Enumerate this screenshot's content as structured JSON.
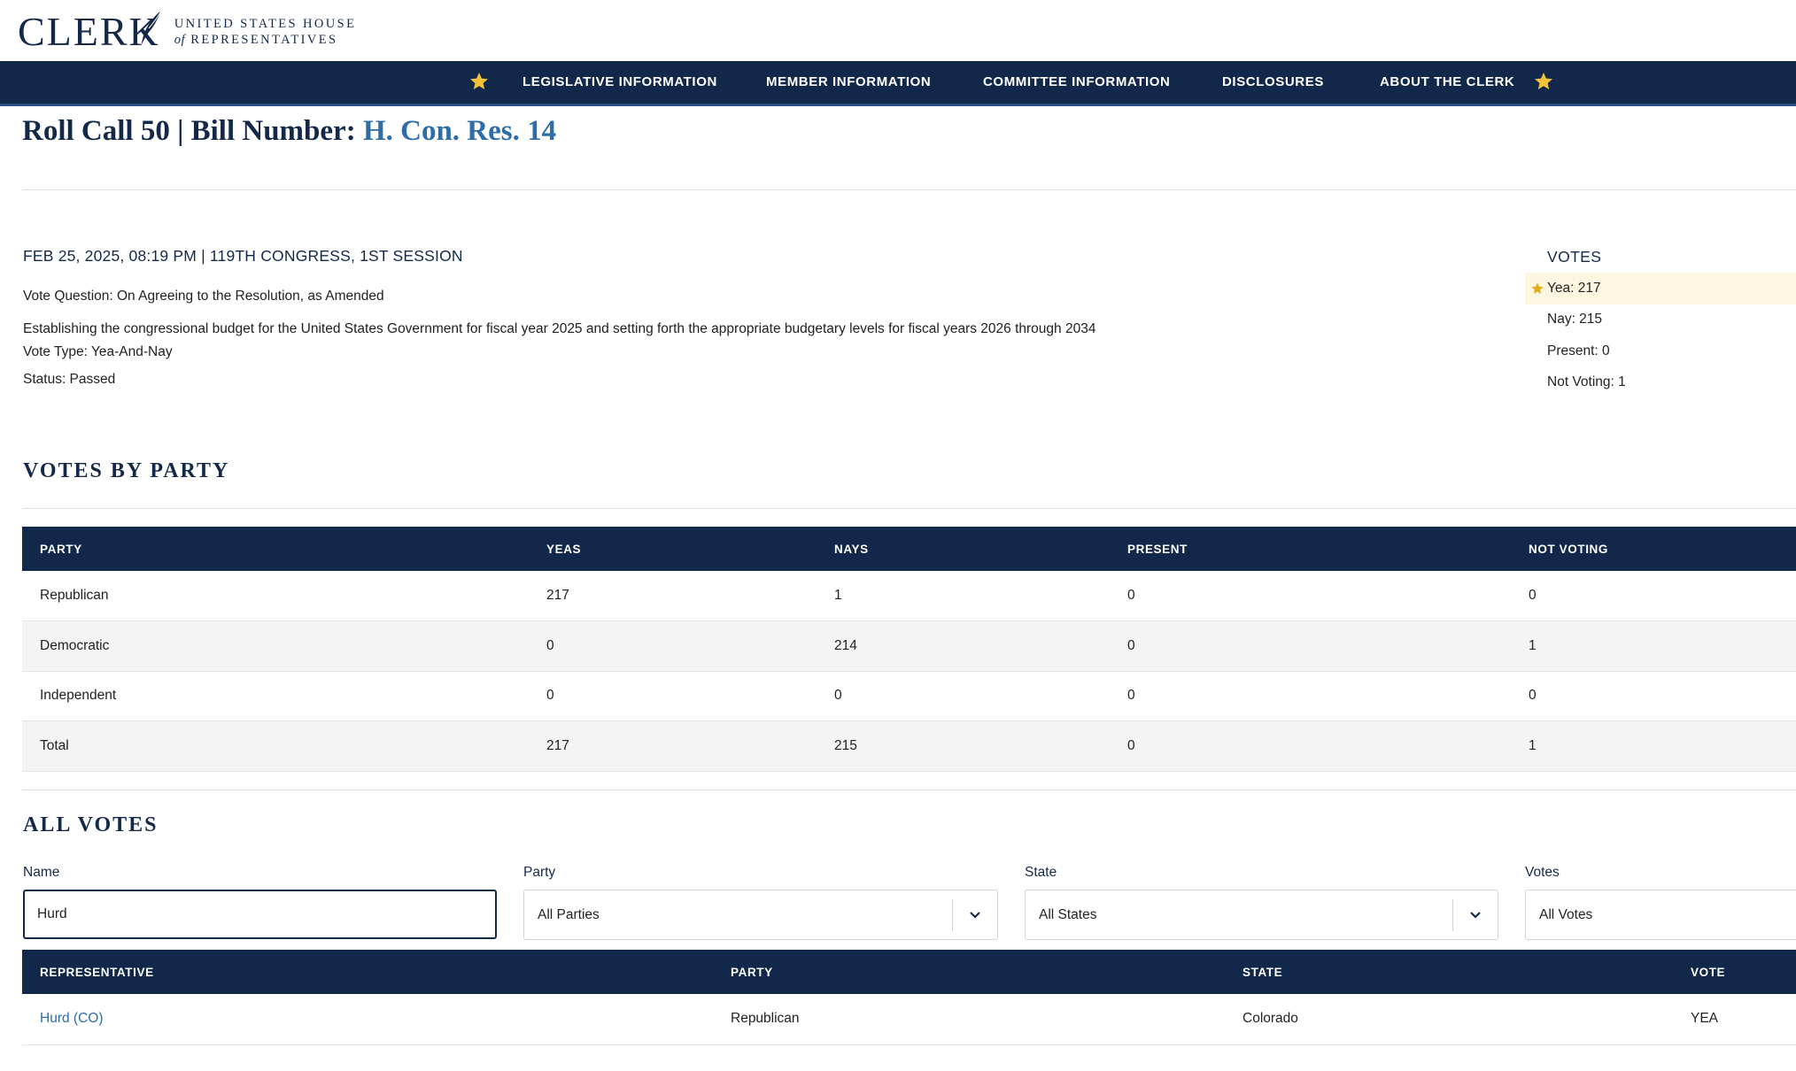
{
  "header": {
    "logo_word": "CLERK",
    "logo_line1": "United States House",
    "logo_of": "of",
    "logo_line2": "Representatives"
  },
  "nav": {
    "items": [
      {
        "label": "LEGISLATIVE INFORMATION"
      },
      {
        "label": "MEMBER INFORMATION"
      },
      {
        "label": "COMMITTEE INFORMATION"
      },
      {
        "label": "DISCLOSURES"
      },
      {
        "label": "ABOUT THE CLERK"
      }
    ],
    "star_color": "#f2c23a"
  },
  "title": {
    "prefix": "Roll Call 50 | Bill Number: ",
    "bill": "H. Con. Res. 14"
  },
  "meta": {
    "heading": "FEB 25, 2025, 08:19 PM | 119TH CONGRESS, 1ST SESSION",
    "question": "Vote Question: On Agreeing to the Resolution, as Amended",
    "description": "Establishing the congressional budget for the United States Government for fiscal year 2025 and setting forth the appropriate budgetary levels for fiscal years 2026 through 2034",
    "type": "Vote Type: Yea-And-Nay",
    "status": "Status: Passed"
  },
  "votes_summary": {
    "title": "VOTES",
    "items": [
      {
        "label": "Yea: 217"
      },
      {
        "label": "Nay: 215"
      },
      {
        "label": "Present: 0"
      },
      {
        "label": "Not Voting: 1"
      }
    ]
  },
  "party_section": {
    "heading": "VOTES BY PARTY",
    "columns": [
      "PARTY",
      "YEAS",
      "NAYS",
      "PRESENT",
      "NOT VOTING"
    ],
    "rows": [
      [
        "Republican",
        "217",
        "1",
        "0",
        "0"
      ],
      [
        "Democratic",
        "0",
        "214",
        "0",
        "1"
      ],
      [
        "Independent",
        "0",
        "0",
        "0",
        "0"
      ],
      [
        "Total",
        "217",
        "215",
        "0",
        "1"
      ]
    ]
  },
  "all_votes": {
    "heading": "ALL VOTES",
    "filters": {
      "name_label": "Name",
      "name_value": "Hurd",
      "party_label": "Party",
      "party_value": "All Parties",
      "state_label": "State",
      "state_value": "All States",
      "votes_label": "Votes",
      "votes_value": "All Votes"
    },
    "columns": [
      "REPRESENTATIVE",
      "PARTY",
      "STATE",
      "VOTE"
    ],
    "rows": [
      [
        "Hurd (CO)",
        "Republican",
        "Colorado",
        "YEA"
      ]
    ]
  },
  "colors": {
    "navy": "#11284a",
    "link": "#2f6da8",
    "highlight": "#fdf7e2",
    "star": "#f2c23a"
  }
}
